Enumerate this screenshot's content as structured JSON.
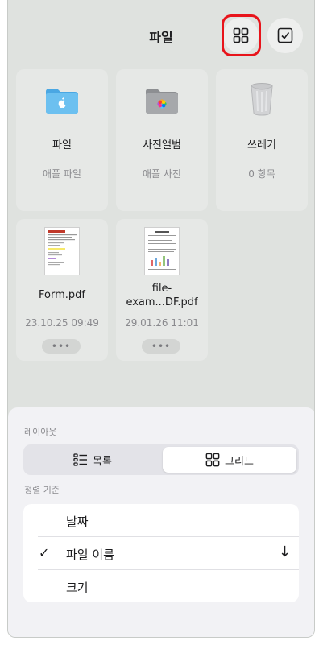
{
  "header": {
    "title": "파일",
    "grid_icon": "grid-icon",
    "select_icon": "checkbox-icon"
  },
  "items": [
    {
      "name": "파일",
      "subtitle": "애플 파일",
      "icon": "blue-folder-apple-icon"
    },
    {
      "name": "사진앨범",
      "subtitle": "애플 사진",
      "icon": "gray-folder-photos-icon"
    },
    {
      "name": "쓰레기",
      "subtitle": "0 항목",
      "icon": "trash-icon"
    },
    {
      "name": "Form.pdf",
      "subtitle": "23.10.25 09:49",
      "more": "•••"
    },
    {
      "name_line1": "file-",
      "name_line2": "exam...DF.pdf",
      "subtitle": "29.01.26 11:01",
      "more": "•••"
    }
  ],
  "sheet": {
    "layout_label": "레이아웃",
    "layout_options": [
      {
        "label": "목록",
        "icon": "list-icon",
        "selected": false
      },
      {
        "label": "그리드",
        "icon": "grid-icon",
        "selected": true
      }
    ],
    "sort_label": "정렬 기준",
    "sort_options": [
      {
        "label": "날짜",
        "checked": false
      },
      {
        "label": "파일 이름",
        "checked": true,
        "check": "✓",
        "direction": "↓"
      },
      {
        "label": "크기",
        "checked": false
      }
    ]
  },
  "colors": {
    "highlight": "#e8141b",
    "folder_blue": "#5ab4ea",
    "background": "#dfe2df"
  }
}
